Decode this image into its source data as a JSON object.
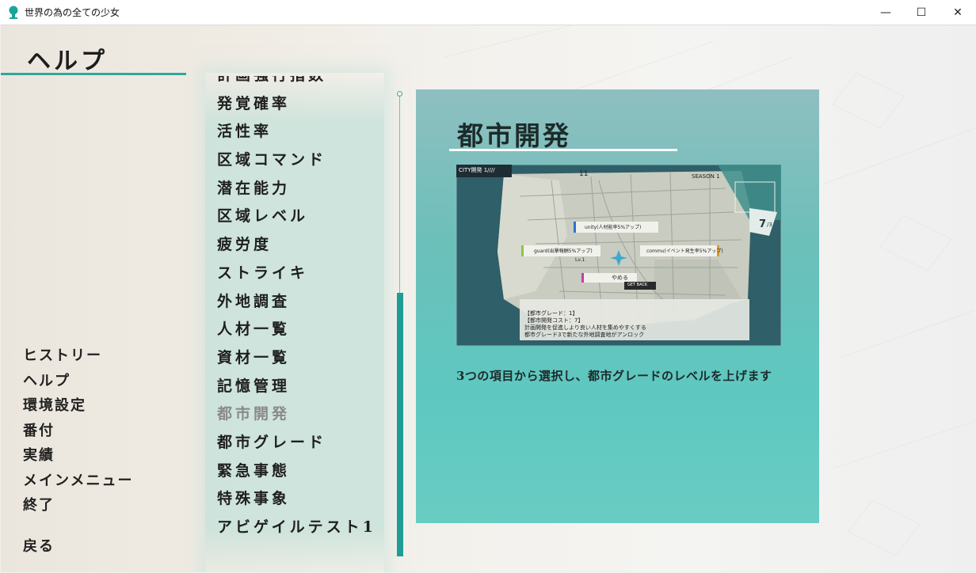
{
  "window": {
    "title": "世界の為の全ての少女",
    "controls": {
      "minimize": "—",
      "maximize": "☐",
      "close": "✕"
    }
  },
  "page": {
    "title": "ヘルプ"
  },
  "left_menu": {
    "items": [
      "ヒストリー",
      "ヘルプ",
      "環境設定",
      "番付",
      "実績",
      "メインメニュー",
      "終了"
    ],
    "back": "戻る"
  },
  "topics": {
    "items": [
      "計画強行指数",
      "発覚確率",
      "活性率",
      "区域コマンド",
      "潜在能力",
      "区域レベル",
      "疲労度",
      "ストライキ",
      "外地調査",
      "人材一覧",
      "資材一覧",
      "記憶管理",
      "都市開発",
      "都市グレード",
      "緊急事態",
      "特殊事象",
      "アビゲイルテスト1"
    ],
    "selected_index": 12
  },
  "detail": {
    "heading": "都市開発",
    "description": "3つの項目から選択し、都市グレードのレベルを上げます",
    "screenshot": {
      "city_label": "CITY開発 1////",
      "stat_value": "11",
      "season": "SEASON 1",
      "counter": "7",
      "counter_total": "/3",
      "option_top": "unity(人材能率5%アップ)",
      "option_left": "guard(出撃報酬5%アップ)",
      "option_right": "commu(イベント発生率5%アップ)",
      "option_level": "Lv.1",
      "quit_label": "やめる",
      "get_back_label": "GET BACK",
      "info_lines": [
        "【都市グレード：1】",
        "【都市開発コスト：7】",
        "計画開発を促進しより良い人材を集めやすくする",
        "都市グレード3で新たな外地調査地がアンロック"
      ]
    }
  },
  "colors": {
    "accent": "#2fa79d",
    "panel": "#5ec8c0",
    "scroll_thumb": "#1f9d94"
  }
}
